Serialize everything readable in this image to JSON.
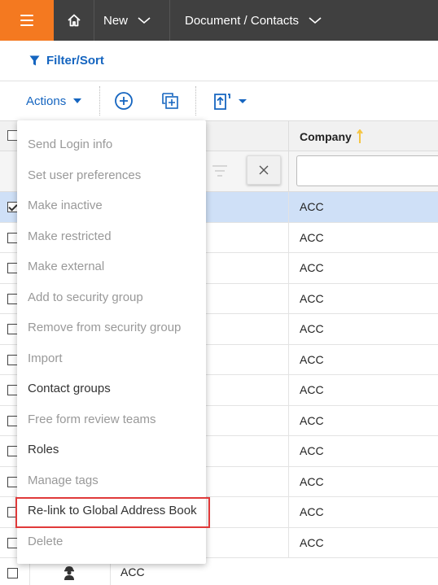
{
  "topbar": {
    "new_label": "New",
    "breadcrumb_label": "Document / Contacts"
  },
  "filter_sort": {
    "label": "Filter/Sort"
  },
  "toolbar": {
    "actions_label": "Actions"
  },
  "grid": {
    "company_header": "Company",
    "rows": [
      {
        "company": "ACC",
        "checked": true
      },
      {
        "company": "ACC",
        "checked": false
      },
      {
        "company": "ACC",
        "checked": false
      },
      {
        "company": "ACC",
        "checked": false
      },
      {
        "company": "ACC",
        "checked": false
      },
      {
        "company": "ACC",
        "checked": false
      },
      {
        "company": "ACC",
        "checked": false
      },
      {
        "company": "ACC",
        "checked": false
      },
      {
        "company": "ACC",
        "checked": false
      },
      {
        "company": "ACC",
        "checked": false
      },
      {
        "company": "ACC",
        "checked": false
      },
      {
        "company": "ACC",
        "checked": false
      }
    ],
    "last_row_company": "ACC"
  },
  "actions_menu": {
    "items": [
      {
        "label": "Send Login info",
        "enabled": false
      },
      {
        "label": "Set user preferences",
        "enabled": false
      },
      {
        "label": "Make inactive",
        "enabled": false
      },
      {
        "label": "Make restricted",
        "enabled": false
      },
      {
        "label": "Make external",
        "enabled": false
      },
      {
        "label": "Add to security group",
        "enabled": false
      },
      {
        "label": "Remove from security group",
        "enabled": false
      },
      {
        "label": "Import",
        "enabled": false
      },
      {
        "label": "Contact groups",
        "enabled": true
      },
      {
        "label": "Free form review teams",
        "enabled": false
      },
      {
        "label": "Roles",
        "enabled": true
      },
      {
        "label": "Manage tags",
        "enabled": false
      },
      {
        "label": "Re-link to Global Address Book",
        "enabled": true
      },
      {
        "label": "Delete",
        "enabled": false
      }
    ]
  },
  "colors": {
    "topbar": "#404040",
    "menu_button": "#f47920",
    "accent_blue": "#1565c0",
    "selected_row": "#cfe0f7",
    "highlight_border": "#e03a3a",
    "sort_arrow": "#f5c542"
  }
}
